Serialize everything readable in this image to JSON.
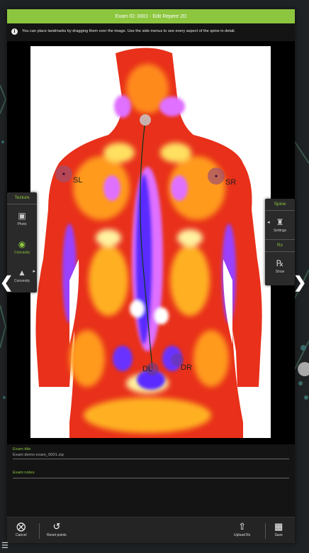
{
  "title": "Exam ID: 0001 - Edit Repere 2D",
  "info_text": "You can place landmarks by dragging them over the image. Use the side menus to see every aspect of the spine in detail.",
  "left_panel": {
    "header": "Texture",
    "items": [
      {
        "label": "Photo",
        "icon": "photo-icon"
      },
      {
        "label": "Concavity",
        "icon": "concavity-icon",
        "active": true
      },
      {
        "label": "Convexity",
        "icon": "convexity-icon"
      }
    ]
  },
  "right_panel": {
    "header": "Spine",
    "settings_label": "Settings",
    "rx_header": "Rx",
    "show_label": "Show"
  },
  "landmarks": {
    "sl": "SL",
    "sr": "SR",
    "dl": "DL",
    "dr": "DR"
  },
  "fields": {
    "exam_title_label": "Exam title",
    "exam_title_value": "Exam demo exam_0001.zip",
    "exam_notes_label": "Exam notes",
    "exam_notes_value": ""
  },
  "footer": {
    "cancel": "Cancel",
    "reset": "Reset points",
    "upload": "Upload Rx",
    "save": "Save"
  },
  "colors": {
    "accent": "#8cc63f",
    "dark": "#141414"
  }
}
